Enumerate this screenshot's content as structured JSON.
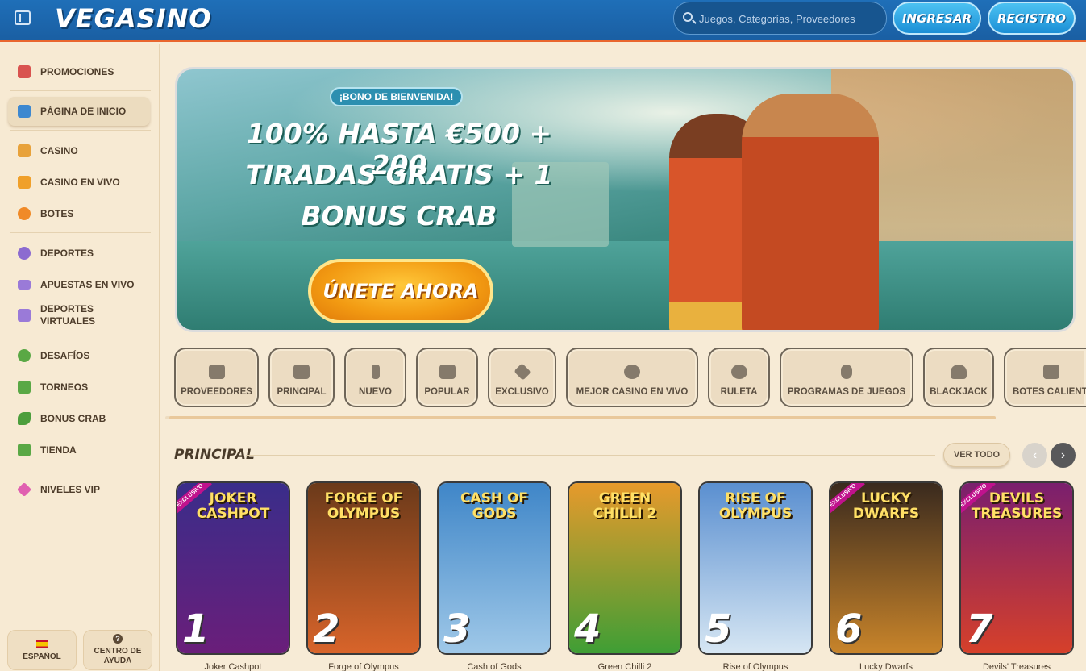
{
  "header": {
    "logo": "VEGASINO",
    "search_placeholder": "Juegos, Categorías, Proveedores",
    "login_label": "INGRESAR",
    "register_label": "REGISTRO"
  },
  "sidebar": {
    "items": [
      {
        "label": "PROMOCIONES",
        "icon": "gift-icon"
      },
      {
        "label": "PÁGINA DE INICIO",
        "icon": "home-icon"
      },
      {
        "label": "CASINO",
        "icon": "slot-machine-icon"
      },
      {
        "label": "CASINO EN VIVO",
        "icon": "live-casino-icon"
      },
      {
        "label": "BOTES",
        "icon": "clover-icon"
      },
      {
        "label": "DEPORTES",
        "icon": "ball-icon"
      },
      {
        "label": "APUESTAS EN VIVO",
        "icon": "live-badge-icon"
      },
      {
        "label": "DEPORTES VIRTUALES",
        "icon": "virtual-sports-icon"
      },
      {
        "label": "DESAFÍOS",
        "icon": "medal-icon"
      },
      {
        "label": "TORNEOS",
        "icon": "trophy-icon"
      },
      {
        "label": "BONUS CRAB",
        "icon": "crab-icon"
      },
      {
        "label": "TIENDA",
        "icon": "shopping-bag-icon"
      },
      {
        "label": "NIVELES VIP",
        "icon": "diamond-icon"
      }
    ],
    "language_label": "ESPAÑOL",
    "help_label": "CENTRO DE AYUDA",
    "help_icon_glyph": "?"
  },
  "banner": {
    "badge": "¡BONO DE BIENVENIDA!",
    "line1": "100% HASTA €500 + 200",
    "line2": "TIRADAS GRATIS + 1",
    "line3": "BONUS CRAB",
    "cta": "ÚNETE AHORA"
  },
  "categories": [
    {
      "label": "PROVEEDORES",
      "icon": "folder-icon"
    },
    {
      "label": "PRINCIPAL",
      "icon": "crown-icon"
    },
    {
      "label": "NUEVO",
      "icon": "lightning-icon"
    },
    {
      "label": "POPULAR",
      "icon": "thumbs-up-icon"
    },
    {
      "label": "EXCLUSIVO",
      "icon": "diamond-icon"
    },
    {
      "label": "MEJOR CASINO EN VIVO",
      "icon": "award-icon"
    },
    {
      "label": "RULETA",
      "icon": "roulette-icon"
    },
    {
      "label": "PROGRAMAS DE JUEGOS",
      "icon": "microphone-icon"
    },
    {
      "label": "BLACKJACK",
      "icon": "spade-icon"
    },
    {
      "label": "BOTES CALIENTES",
      "icon": "fire-pot-icon"
    }
  ],
  "principal": {
    "title": "PRINCIPAL",
    "see_all": "VER TODO",
    "prev_glyph": "‹",
    "next_glyph": "›",
    "games": [
      {
        "rank": "1",
        "title": "JOKER CASHPOT",
        "name": "Joker Cashpot",
        "exclusive_badge": "EXCLUSIVO",
        "color1": "#3a2d8a",
        "color2": "#6a1e7a"
      },
      {
        "rank": "2",
        "title": "FORGE OF OLYMPUS",
        "name": "Forge of Olympus",
        "color1": "#6b3a1a",
        "color2": "#d8642a"
      },
      {
        "rank": "3",
        "title": "CASH OF GODS",
        "name": "Cash of Gods",
        "color1": "#3f86c8",
        "color2": "#9fc8e8"
      },
      {
        "rank": "4",
        "title": "GREEN CHILLI 2",
        "name": "Green Chilli 2",
        "color1": "#e79a2c",
        "color2": "#3f9e35"
      },
      {
        "rank": "5",
        "title": "RISE OF OLYMPUS",
        "name": "Rise of Olympus",
        "color1": "#5a8fd0",
        "color2": "#d6e6f3"
      },
      {
        "rank": "6",
        "title": "LUCKY DWARFS",
        "name": "Lucky Dwarfs",
        "exclusive_badge": "EXCLUSIVO",
        "color1": "#3a2a1e",
        "color2": "#c8842a"
      },
      {
        "rank": "7",
        "title": "DEVILS TREASURES",
        "name": "Devils' Treasures",
        "exclusive_badge": "EXCLUSIVO",
        "color1": "#7a1f6e",
        "color2": "#d6402a"
      }
    ]
  }
}
